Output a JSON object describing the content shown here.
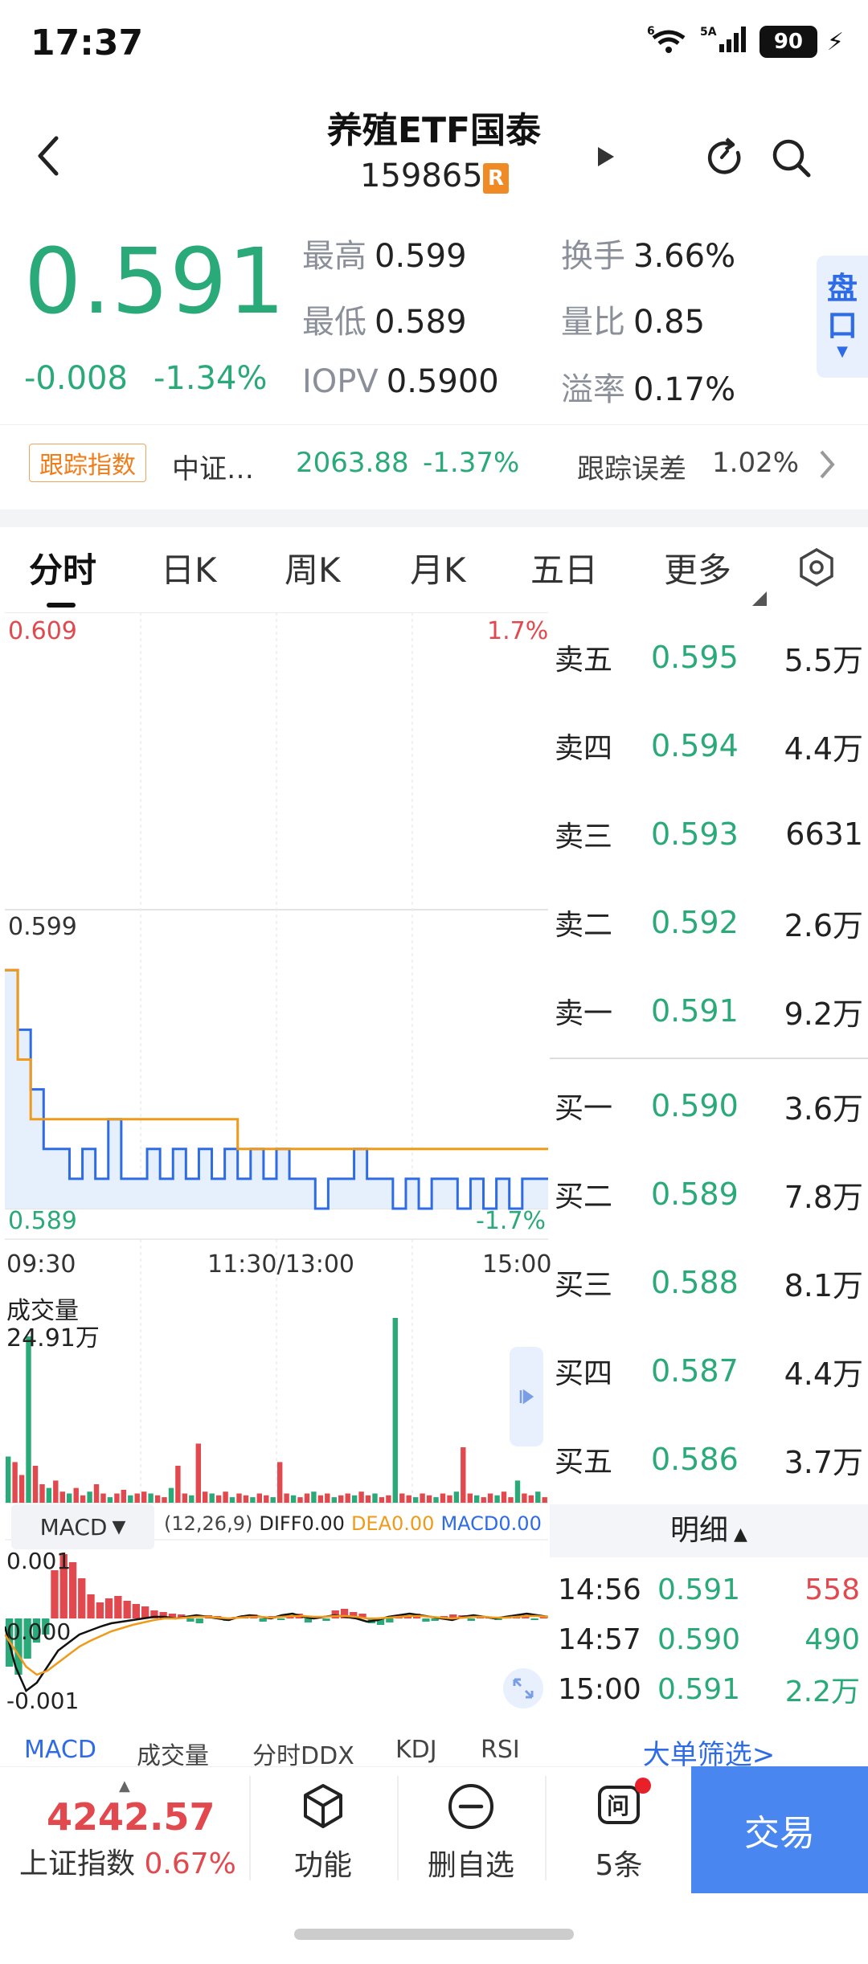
{
  "status_bar": {
    "time": "17:37",
    "net1": "6",
    "net2": "5A",
    "battery": "90"
  },
  "header": {
    "title": "养殖ETF国泰",
    "code": "159865",
    "badge": "R"
  },
  "quote": {
    "price": "0.591",
    "change": "-0.008",
    "change_pct": "-1.34%",
    "high_label": "最高",
    "high": "0.599",
    "low_label": "最低",
    "low": "0.589",
    "iopv_label": "IOPV",
    "iopv": "0.5900",
    "turnover_label": "换手",
    "turnover": "3.66%",
    "volratio_label": "量比",
    "volratio": "0.85",
    "premium_label": "溢率",
    "premium": "0.17%",
    "pankou": "盘口"
  },
  "tracking": {
    "badge": "跟踪指数",
    "index_name": "中证…",
    "index_value": "2063.88",
    "index_pct": "-1.37%",
    "error_label": "跟踪误差",
    "error_value": "1.02%"
  },
  "tabs": [
    "分时",
    "日K",
    "周K",
    "月K",
    "五日",
    "更多"
  ],
  "chart": {
    "y_top": "0.609",
    "y_mid": "0.599",
    "y_bot": "0.589",
    "pct_top": "1.7%",
    "pct_bot": "-1.7%",
    "x_start": "09:30",
    "x_mid": "11:30/13:00",
    "x_end": "15:00",
    "vol_label": "成交量",
    "vol_max": "24.91万",
    "macd_select": "MACD",
    "macd_params": "(12,26,9)",
    "diff": "DIFF0.00",
    "dea": "DEA0.00",
    "macd": "MACD0.00",
    "macd_top": "0.001",
    "macd_mid": "0.000",
    "macd_bot": "-0.001"
  },
  "chart_data": {
    "type": "line",
    "title": "",
    "xlabel": "",
    "ylabel": "",
    "ylim": [
      0.589,
      0.609
    ],
    "x_ticks": [
      "09:30",
      "11:30/13:00",
      "15:00"
    ],
    "series": [
      {
        "name": "",
        "color": "#2e6be6",
        "note": "price",
        "values": [
          0.597,
          0.595,
          0.593,
          0.591,
          0.591,
          0.59,
          0.591,
          0.59,
          0.592,
          0.59,
          0.59,
          0.591,
          0.59,
          0.591,
          0.59,
          0.591,
          0.59,
          0.591,
          0.59,
          0.591,
          0.59,
          0.591,
          0.59,
          0.59,
          0.589,
          0.59,
          0.59,
          0.591,
          0.59,
          0.59,
          0.589,
          0.59,
          0.589,
          0.59,
          0.59,
          0.589,
          0.59,
          0.589,
          0.59,
          0.589,
          0.59,
          0.59,
          0.59
        ]
      },
      {
        "name": "",
        "color": "#f09a1a",
        "note": "avg",
        "values": [
          0.597,
          0.594,
          0.592,
          0.592,
          0.592,
          0.592,
          0.592,
          0.592,
          0.592,
          0.592,
          0.592,
          0.592,
          0.592,
          0.592,
          0.592,
          0.592,
          0.592,
          0.592,
          0.591,
          0.591,
          0.591,
          0.591,
          0.591,
          0.591,
          0.591,
          0.591,
          0.591,
          0.591,
          0.591,
          0.591,
          0.591,
          0.591,
          0.591,
          0.591,
          0.591,
          0.591,
          0.591,
          0.591,
          0.591,
          0.591,
          0.591,
          0.591,
          0.591
        ]
      }
    ]
  },
  "order_book": {
    "asks": [
      {
        "label": "卖五",
        "price": "0.595",
        "vol": "5.5万"
      },
      {
        "label": "卖四",
        "price": "0.594",
        "vol": "4.4万"
      },
      {
        "label": "卖三",
        "price": "0.593",
        "vol": "6631"
      },
      {
        "label": "卖二",
        "price": "0.592",
        "vol": "2.6万"
      },
      {
        "label": "卖一",
        "price": "0.591",
        "vol": "9.2万"
      }
    ],
    "bids": [
      {
        "label": "买一",
        "price": "0.590",
        "vol": "3.6万"
      },
      {
        "label": "买二",
        "price": "0.589",
        "vol": "7.8万"
      },
      {
        "label": "买三",
        "price": "0.588",
        "vol": "8.1万"
      },
      {
        "label": "买四",
        "price": "0.587",
        "vol": "4.4万"
      },
      {
        "label": "买五",
        "price": "0.586",
        "vol": "3.7万"
      }
    ]
  },
  "details": {
    "title": "明细",
    "ticks": [
      {
        "time": "14:56",
        "price": "0.591",
        "vol": "558",
        "color": "#e2494e"
      },
      {
        "time": "14:57",
        "price": "0.590",
        "vol": "490",
        "color": "#2aa979"
      },
      {
        "time": "15:00",
        "price": "0.591",
        "vol": "2.2万",
        "color": "#2aa979"
      }
    ],
    "filter": "大单筛选>"
  },
  "indicator_tabs": [
    "MACD",
    "成交量",
    "分时DDX",
    "KDJ",
    "RSI"
  ],
  "bottom_nav": {
    "index_value": "4242.57",
    "index_name": "上证指数",
    "index_pct": "0.67%",
    "func": "功能",
    "remove": "删自选",
    "msg_count": "5条",
    "trade": "交易"
  }
}
